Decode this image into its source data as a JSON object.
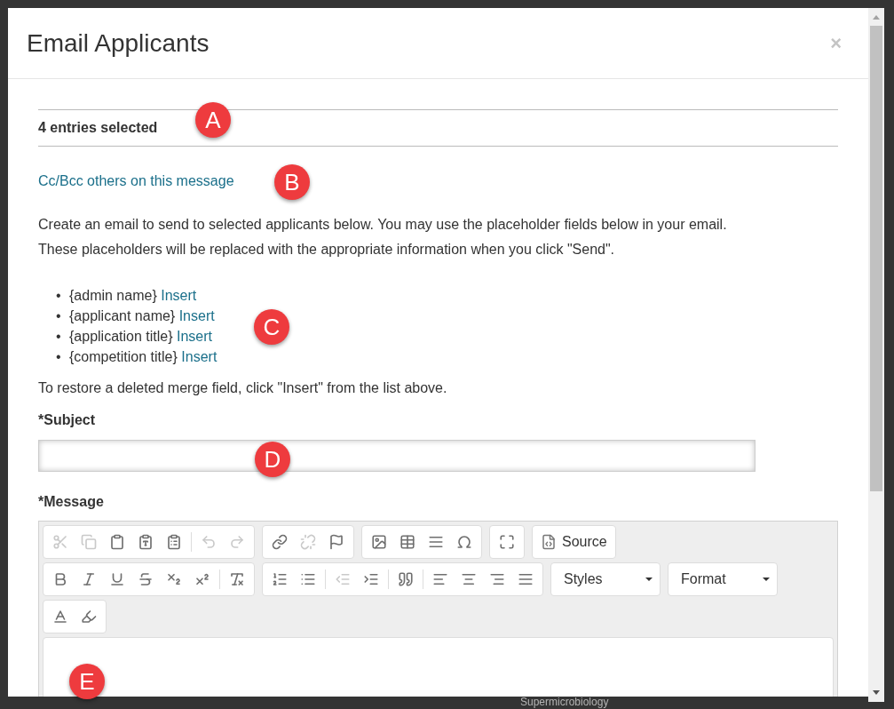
{
  "background_texts": [
    "Supermicrobiology"
  ],
  "dialog": {
    "title": "Email Applicants",
    "close": "×"
  },
  "selection_count": "4 entries selected",
  "cc_link": "Cc/Bcc others on this message",
  "intro": [
    "Create an email to send to selected applicants below. You may use the placeholder fields below in your email.",
    "These placeholders will be replaced with the appropriate information when you click \"Send\"."
  ],
  "placeholders": [
    {
      "bullet": "•",
      "field": "{admin name}",
      "action": "Insert"
    },
    {
      "bullet": "•",
      "field": "{applicant name}",
      "action": "Insert"
    },
    {
      "bullet": "•",
      "field": "{application title}",
      "action": "Insert"
    },
    {
      "bullet": "•",
      "field": "{competition title}",
      "action": "Insert"
    }
  ],
  "restore_note": "To restore a deleted merge field, click \"Insert\" from the list above.",
  "subject": {
    "label": "*Subject"
  },
  "message": {
    "label": "*Message"
  },
  "toolbar_buttons": [
    {
      "disabled": true
    },
    {
      "disabled": true
    },
    {
      "disabled": false
    },
    {
      "disabled": false
    },
    {
      "disabled": false
    },
    {
      "disabled": true
    },
    {
      "disabled": true
    },
    {
      "disabled": false
    },
    {
      "disabled": true
    },
    {
      "disabled": false
    },
    {
      "disabled": false
    },
    {
      "disabled": false
    },
    {
      "disabled": false
    },
    {
      "disabled": false
    },
    {
      "disabled": false
    },
    {
      "disabled": false
    },
    {
      "disabled": false
    },
    {
      "disabled": false
    },
    {
      "disabled": false
    },
    {
      "disabled": false
    },
    {
      "disabled": false
    },
    {
      "disabled": false
    },
    {
      "disabled": false
    },
    {
      "disabled": false
    },
    {
      "disabled": true
    },
    {
      "disabled": false
    },
    {
      "disabled": false
    },
    {
      "disabled": false
    },
    {
      "disabled": false
    },
    {
      "disabled": false
    },
    {
      "disabled": false
    },
    {
      "disabled": false
    },
    {
      "disabled": false
    }
  ],
  "source_button": "Source",
  "dropdowns": [
    "Styles",
    "Format"
  ],
  "callouts": [
    "A",
    "B",
    "C",
    "D",
    "E"
  ]
}
